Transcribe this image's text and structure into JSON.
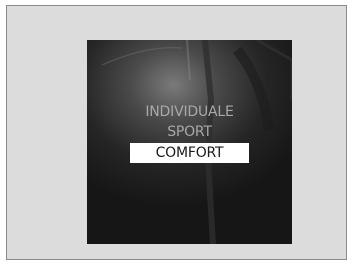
{
  "mode_menu": {
    "items": [
      {
        "label": "INDIVIDUALE",
        "selected": false
      },
      {
        "label": "SPORT",
        "selected": false
      },
      {
        "label": "COMFORT",
        "selected": true
      }
    ]
  },
  "colors": {
    "background": "#dcdcdc",
    "screen": "#1b1b1b",
    "inactive_text": "#a8a8a8",
    "highlight": "#ffffff",
    "highlight_text": "#1a1a1a"
  }
}
